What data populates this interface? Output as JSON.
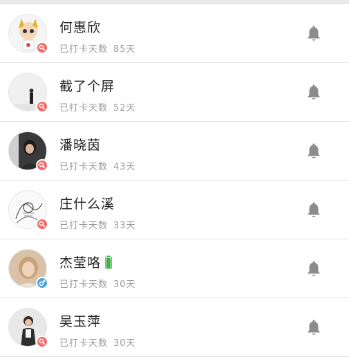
{
  "colors": {
    "badge_female": "#f26a6a",
    "badge_male": "#4aa3df",
    "bell": "#8c8c8c",
    "name_text": "#222222",
    "meta_text": "#9a9a9a",
    "battery": "#3cb043"
  },
  "icons": {
    "row_action": "bell-icon",
    "badge_female": "magnifier-female-icon",
    "badge_male": "male-symbol-icon",
    "battery": "battery-icon"
  },
  "rows": [
    {
      "name": "何惠欣",
      "days_label": "已打卡天数",
      "days_value": "85天",
      "gender": "female",
      "has_battery": false
    },
    {
      "name": "截了个屏",
      "days_label": "已打卡天数",
      "days_value": "52天",
      "gender": "female",
      "has_battery": false
    },
    {
      "name": "潘晓茵",
      "days_label": "已打卡天数",
      "days_value": "43天",
      "gender": "female",
      "has_battery": false
    },
    {
      "name": "庄什么溪",
      "days_label": "已打卡天数",
      "days_value": "33天",
      "gender": "female",
      "has_battery": false
    },
    {
      "name": "杰莹咯",
      "days_label": "已打卡天数",
      "days_value": "30天",
      "gender": "male",
      "has_battery": true
    },
    {
      "name": "吴玉萍",
      "days_label": "已打卡天数",
      "days_value": "30天",
      "gender": "female",
      "has_battery": false
    }
  ]
}
